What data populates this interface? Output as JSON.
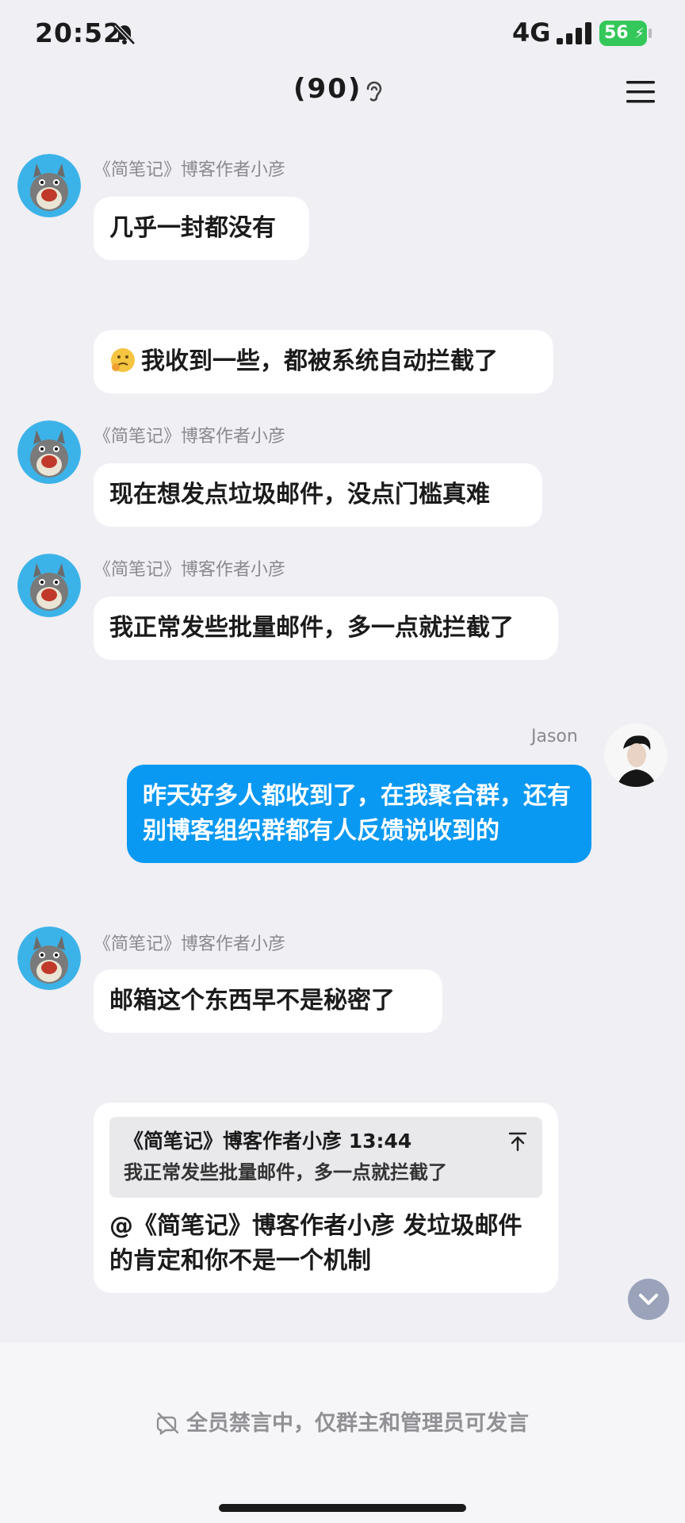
{
  "status_bar": {
    "time": "20:52",
    "network": "4G",
    "battery": "56"
  },
  "header": {
    "title": "(90)"
  },
  "messages": [
    {
      "sender": "《简笔记》博客作者小彦",
      "text": "几乎一封都没有"
    },
    {
      "text": "我收到一些，都被系统自动拦截了"
    },
    {
      "sender": "《简笔记》博客作者小彦",
      "text": "现在想发点垃圾邮件，没点门槛真难"
    },
    {
      "sender": "《简笔记》博客作者小彦",
      "text": "我正常发些批量邮件，多一点就拦截了"
    },
    {
      "sender": "Jason",
      "text": "昨天好多人都收到了，在我聚合群，还有别博客组织群都有人反馈说收到的"
    },
    {
      "sender": "《简笔记》博客作者小彦",
      "text": "邮箱这个东西早不是秘密了"
    },
    {
      "quote_header": "《简笔记》博客作者小彦 13:44",
      "quote_text": "我正常发些批量邮件，多一点就拦截了",
      "text": "@《简笔记》博客作者小彦 发垃圾邮件的肯定和你不是一个机制"
    }
  ],
  "footer": {
    "mute_notice": "全员禁言中，仅群主和管理员可发言"
  }
}
